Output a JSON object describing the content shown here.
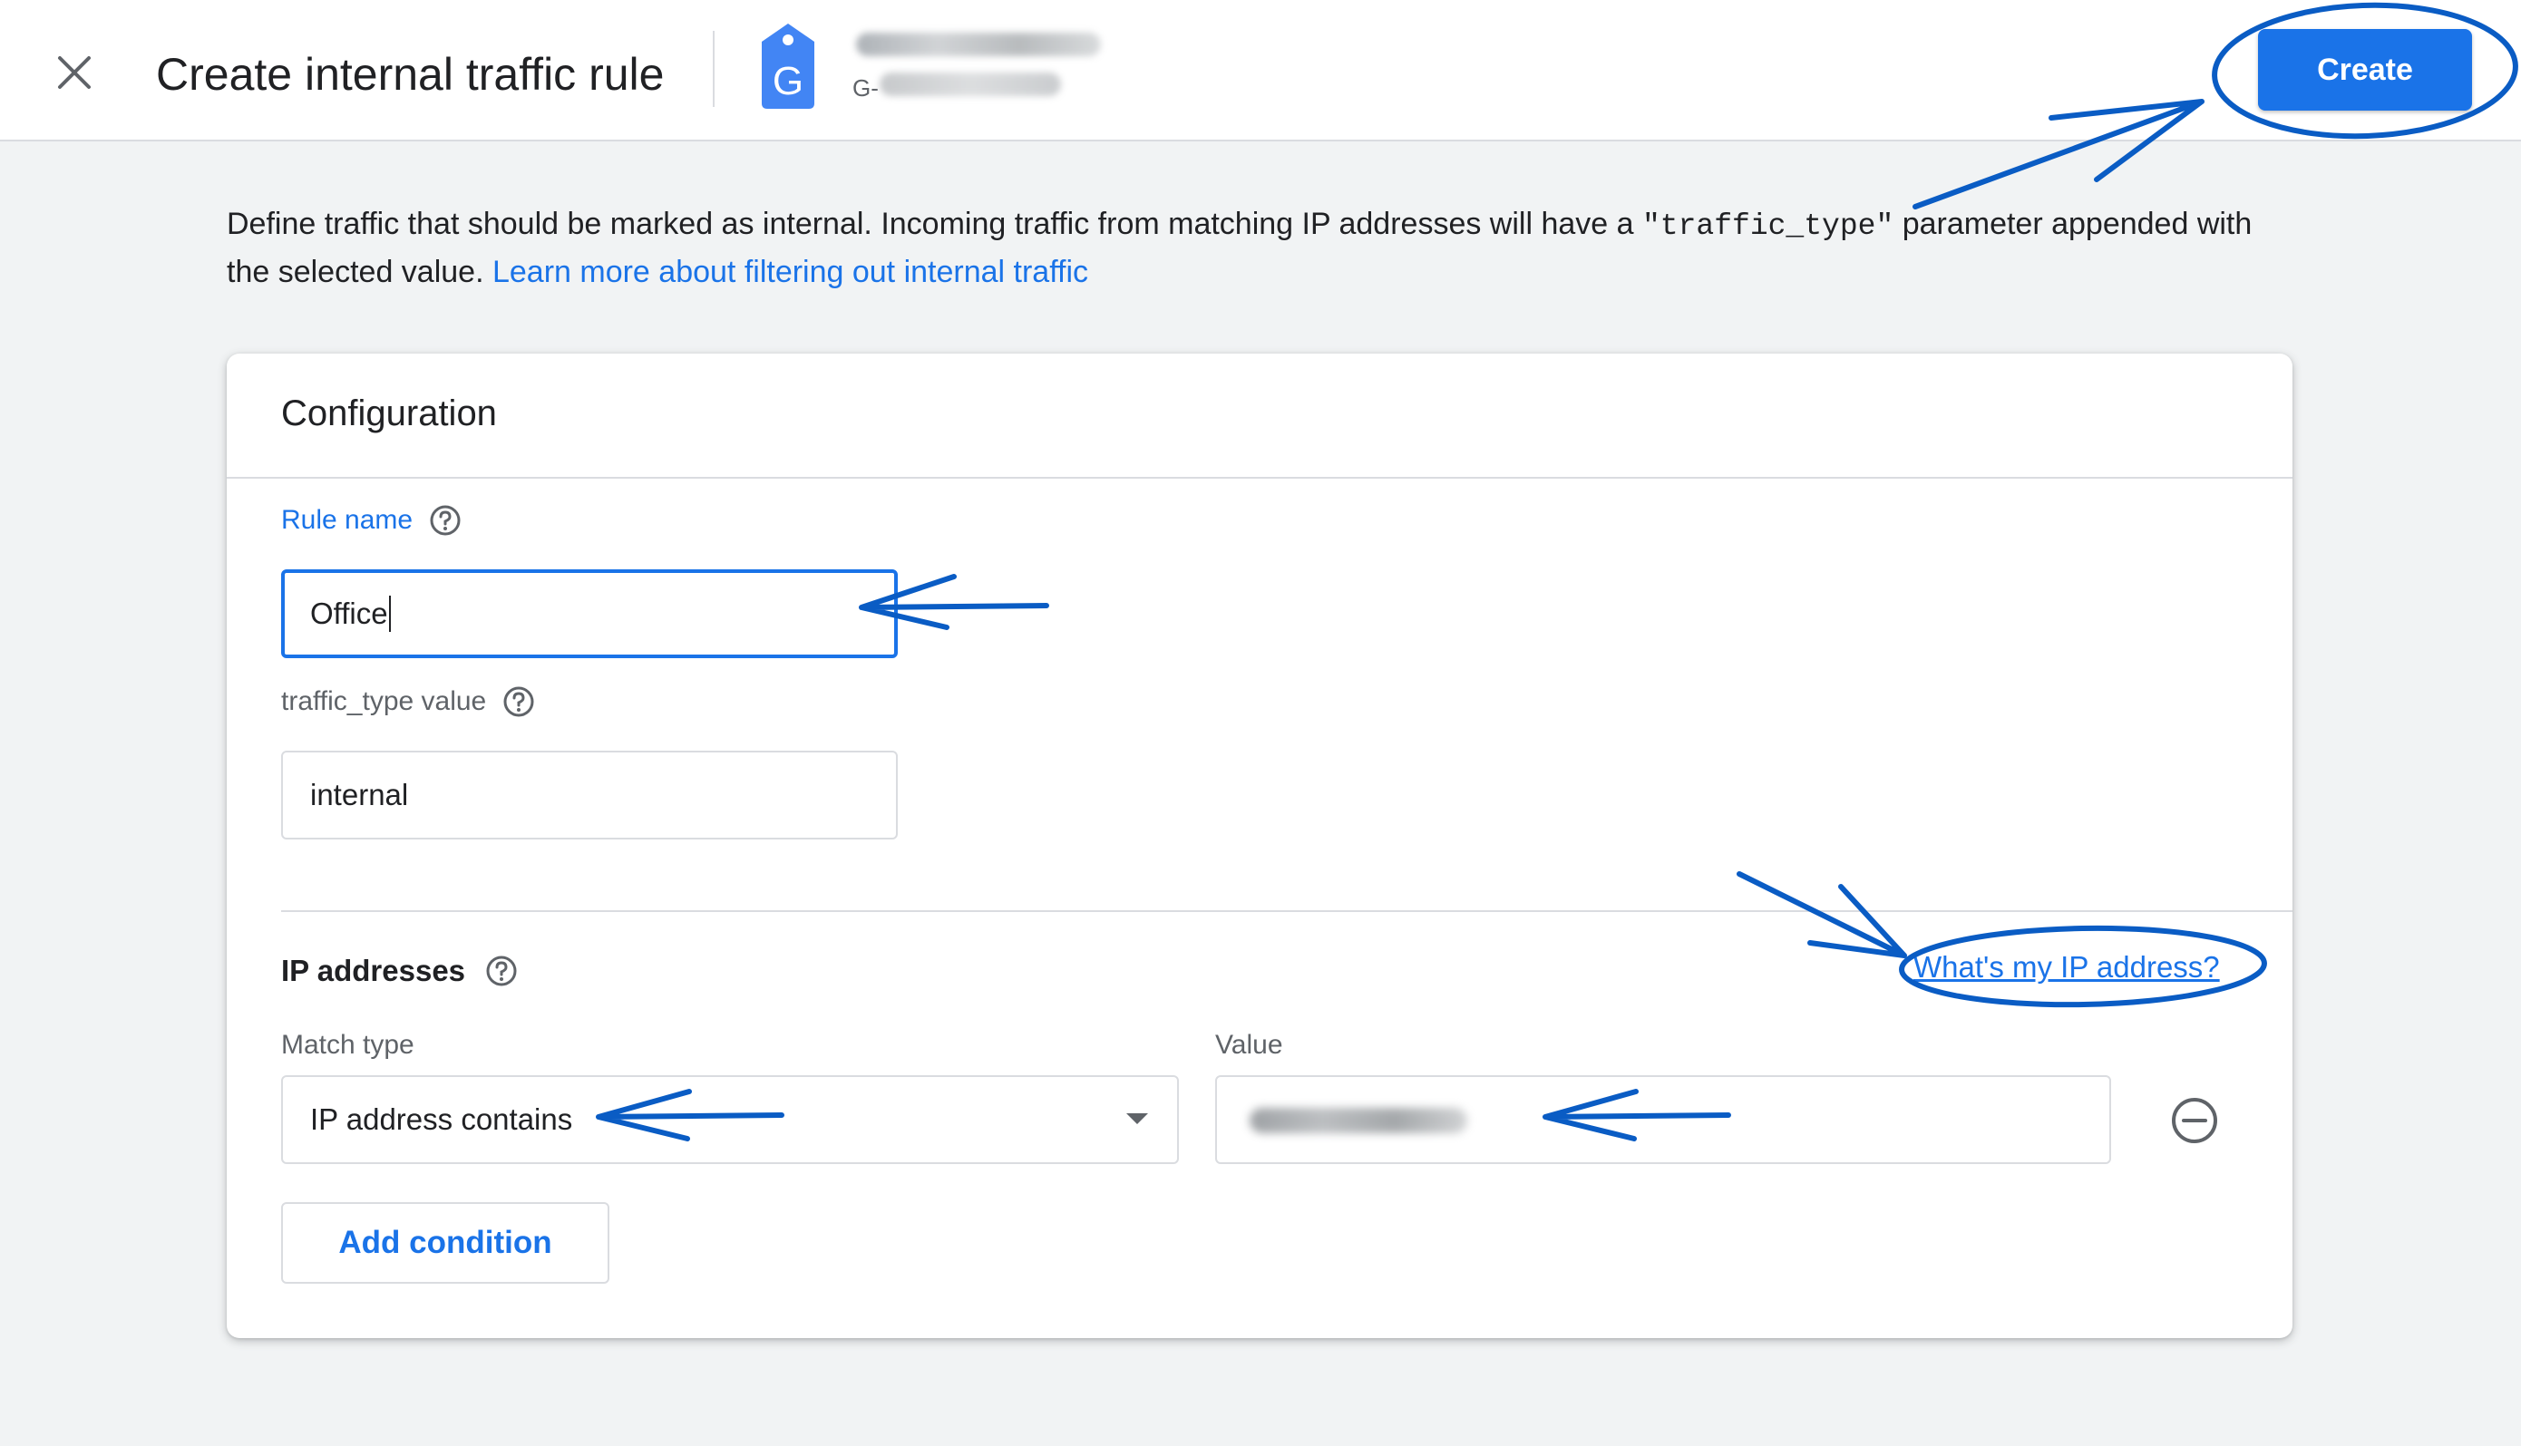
{
  "header": {
    "title": "Create internal traffic rule",
    "property_id_prefix": "G-",
    "create_label": "Create"
  },
  "description": {
    "text_before": "Define traffic that should be marked as internal. Incoming traffic from matching IP addresses will have a ",
    "code": "\"traffic_type\"",
    "text_after": " parameter appended with the selected value. ",
    "link": "Learn more about filtering out internal traffic"
  },
  "config": {
    "title": "Configuration",
    "rule_name": {
      "label": "Rule name",
      "value": "Office"
    },
    "traffic_type": {
      "label": "traffic_type value",
      "value": "internal"
    },
    "ip_section": {
      "title": "IP addresses",
      "link": "What's my IP address?",
      "match_type_label": "Match type",
      "match_type_value": "IP address contains",
      "value_label": "Value",
      "add_condition_label": "Add condition"
    }
  },
  "colors": {
    "accent": "#1a73e8",
    "annotation": "#0a5cc4",
    "background": "#f1f3f4"
  },
  "icons": [
    "close-icon",
    "tag-icon",
    "help-icon",
    "dropdown-arrow-icon",
    "remove-circle-icon"
  ]
}
